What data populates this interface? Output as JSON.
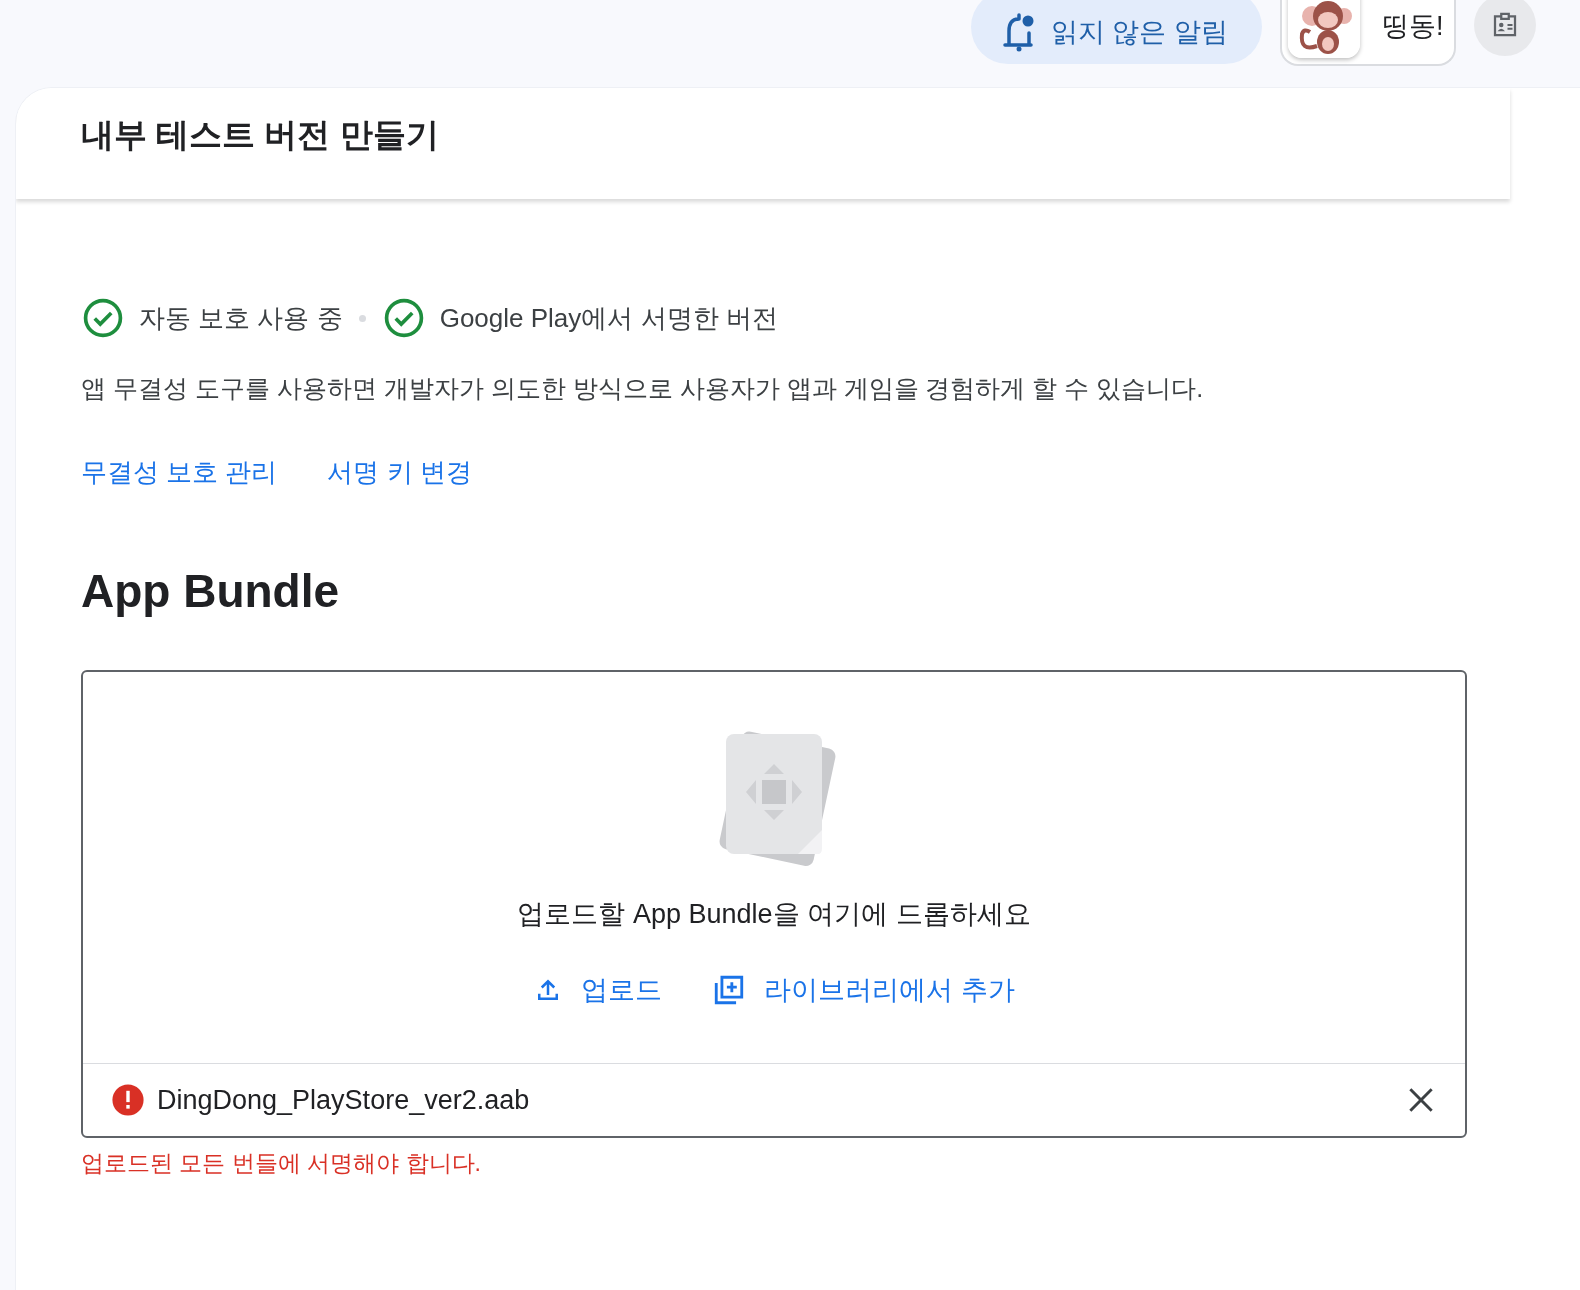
{
  "top_bar": {
    "notifications": {
      "label": "읽지 않은 알림",
      "unread": true
    },
    "account": {
      "name": "띵동!"
    }
  },
  "header": {
    "title": "내부 테스트 버전 만들기"
  },
  "app_integrity": {
    "statuses": [
      {
        "label": "자동 보호 사용 중",
        "checked": true
      },
      {
        "label": "Google Play에서 서명한 버전",
        "checked": true
      }
    ],
    "description": "앱 무결성 도구를 사용하면 개발자가 의도한 방식으로 사용자가 앱과 게임을 경험하게 할 수 있습니다.",
    "links": [
      "무결성 보호 관리",
      "서명 키 변경"
    ]
  },
  "app_bundle": {
    "heading": "App Bundle",
    "dropzone": {
      "prompt": "업로드할 App Bundle을 여기에 드롭하세요",
      "actions": [
        {
          "kind": "upload",
          "label": "업로드"
        },
        {
          "kind": "library",
          "label": "라이브러리에서 추가"
        }
      ]
    },
    "files": [
      {
        "name": "DingDong_PlayStore_ver2.aab",
        "error": true
      }
    ],
    "error_message": "업로드된 모든 번들에 서명해야 합니다."
  }
}
